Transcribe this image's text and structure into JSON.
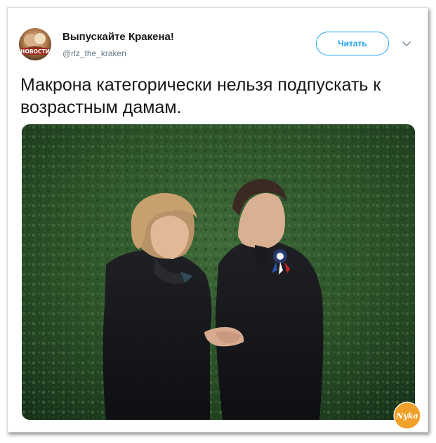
{
  "tweet": {
    "author": {
      "display_name": "Выпускайте Кракена!",
      "handle": "@rlz_the_kraken",
      "avatar_label": "НОВОСТИ"
    },
    "follow_label": "Читать",
    "text": "Макрона категорически нельзя подпускать к возрастным дамам.",
    "photo": {
      "icon": "photo-two-people"
    }
  },
  "watermark": {
    "text": "Nyka",
    "icon": "nyka-logo"
  },
  "colors": {
    "accent": "#1da1f2",
    "text": "#14171a",
    "secondary": "#657786",
    "border": "#d6dbe0",
    "watermark": "#f0a12a"
  }
}
